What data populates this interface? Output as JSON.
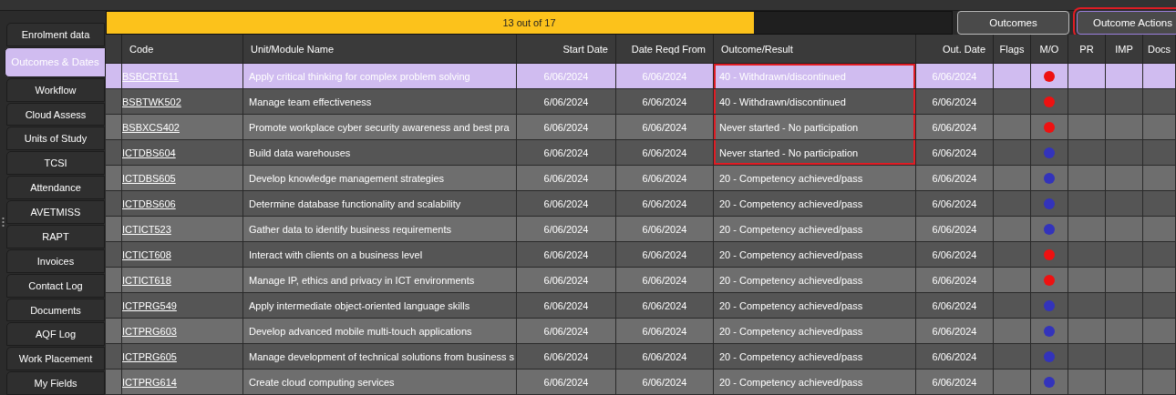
{
  "sidebar": {
    "tabs": [
      {
        "label": "Enrolment data",
        "selected": false
      },
      {
        "label": "Outcomes & Dates",
        "selected": true
      },
      {
        "label": "Workflow",
        "selected": false
      },
      {
        "label": "Cloud Assess",
        "selected": false
      },
      {
        "label": "Units of Study",
        "selected": false
      },
      {
        "label": "TCSI",
        "selected": false
      },
      {
        "label": "Attendance",
        "selected": false
      },
      {
        "label": "AVETMISS",
        "selected": false
      },
      {
        "label": "RAPT",
        "selected": false
      },
      {
        "label": "Invoices",
        "selected": false
      },
      {
        "label": "Contact Log",
        "selected": false
      },
      {
        "label": "Documents",
        "selected": false
      },
      {
        "label": "AQF Log",
        "selected": false
      },
      {
        "label": "Work Placement",
        "selected": false
      },
      {
        "label": "My Fields",
        "selected": false
      }
    ]
  },
  "progress": {
    "label": "13 out of 17",
    "level": 0.766
  },
  "buttons": [
    {
      "label": "Outcomes",
      "highlighted": false
    },
    {
      "label": "Outcome Actions",
      "highlighted": true
    }
  ],
  "table": {
    "columns": [
      "Code",
      "Unit/Module Name",
      "Start Date",
      "Date Reqd From",
      "Outcome/Result",
      "Out. Date",
      "Flags",
      "M/O",
      "PR",
      "IMP",
      "Docs"
    ],
    "rows": [
      {
        "code": "BSBCRT611",
        "name": "Apply critical thinking for complex problem solving",
        "start": "6/06/2024",
        "reqd": "6/06/2024",
        "outcome": "40 - Withdrawn/discontinued",
        "out_date": "6/06/2024",
        "color": "#ee1111",
        "selected": true,
        "highlighted": true
      },
      {
        "code": "BSBTWK502",
        "name": "Manage team effectiveness",
        "start": "6/06/2024",
        "reqd": "6/06/2024",
        "outcome": "40 - Withdrawn/discontinued",
        "out_date": "6/06/2024",
        "color": "#ee1111",
        "selected": false,
        "highlighted": true
      },
      {
        "code": "BSBXCS402",
        "name": "Promote workplace cyber security awareness and best pra",
        "start": "6/06/2024",
        "reqd": "6/06/2024",
        "outcome": "Never started - No participation",
        "out_date": "6/06/2024",
        "color": "#ee1111",
        "selected": false,
        "highlighted": true
      },
      {
        "code": "ICTDBS604",
        "name": "Build data warehouses",
        "start": "6/06/2024",
        "reqd": "6/06/2024",
        "outcome": "Never started - No participation",
        "out_date": "6/06/2024",
        "color": "#3333bb",
        "selected": false,
        "highlighted": true
      },
      {
        "code": "ICTDBS605",
        "name": "Develop knowledge management strategies",
        "start": "6/06/2024",
        "reqd": "6/06/2024",
        "outcome": "20 - Competency achieved/pass",
        "out_date": "6/06/2024",
        "color": "#3333bb",
        "selected": false,
        "highlighted": false
      },
      {
        "code": "ICTDBS606",
        "name": "Determine database functionality and scalability",
        "start": "6/06/2024",
        "reqd": "6/06/2024",
        "outcome": "20 - Competency achieved/pass",
        "out_date": "6/06/2024",
        "color": "#3333bb",
        "selected": false,
        "highlighted": false
      },
      {
        "code": "ICTICT523",
        "name": "Gather data to identify business requirements",
        "start": "6/06/2024",
        "reqd": "6/06/2024",
        "outcome": "20 - Competency achieved/pass",
        "out_date": "6/06/2024",
        "color": "#3333bb",
        "selected": false,
        "highlighted": false
      },
      {
        "code": "ICTICT608",
        "name": "Interact with clients on a business level",
        "start": "6/06/2024",
        "reqd": "6/06/2024",
        "outcome": "20 - Competency achieved/pass",
        "out_date": "6/06/2024",
        "color": "#ee1111",
        "selected": false,
        "highlighted": false
      },
      {
        "code": "ICTICT618",
        "name": "Manage IP, ethics and privacy in ICT environments",
        "start": "6/06/2024",
        "reqd": "6/06/2024",
        "outcome": "20 - Competency achieved/pass",
        "out_date": "6/06/2024",
        "color": "#ee1111",
        "selected": false,
        "highlighted": false
      },
      {
        "code": "ICTPRG549",
        "name": "Apply intermediate object-oriented language skills",
        "start": "6/06/2024",
        "reqd": "6/06/2024",
        "outcome": "20 - Competency achieved/pass",
        "out_date": "6/06/2024",
        "color": "#3333bb",
        "selected": false,
        "highlighted": false
      },
      {
        "code": "ICTPRG603",
        "name": "Develop advanced mobile multi-touch applications",
        "start": "6/06/2024",
        "reqd": "6/06/2024",
        "outcome": "20 - Competency achieved/pass",
        "out_date": "6/06/2024",
        "color": "#3333bb",
        "selected": false,
        "highlighted": false
      },
      {
        "code": "ICTPRG605",
        "name": "Manage development of technical solutions from business s",
        "start": "6/06/2024",
        "reqd": "6/06/2024",
        "outcome": "20 - Competency achieved/pass",
        "out_date": "6/06/2024",
        "color": "#3333bb",
        "selected": false,
        "highlighted": false
      },
      {
        "code": "ICTPRG614",
        "name": "Create cloud computing services",
        "start": "6/06/2024",
        "reqd": "6/06/2024",
        "outcome": "20 - Competency achieved/pass",
        "out_date": "6/06/2024",
        "color": "#3333bb",
        "selected": false,
        "highlighted": false
      }
    ]
  }
}
